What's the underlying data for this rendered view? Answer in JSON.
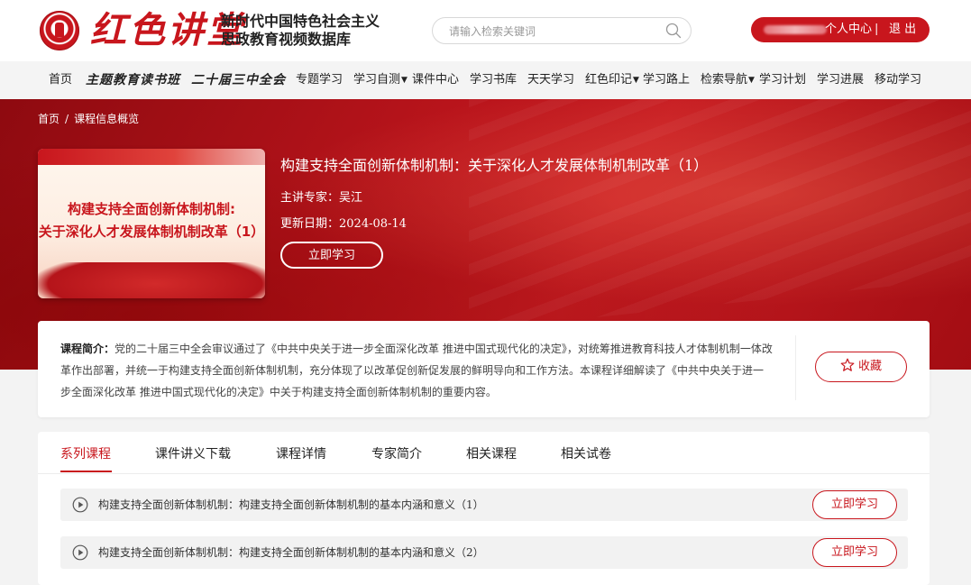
{
  "header": {
    "logo_text": "红色讲堂",
    "subtitle_line1": "新时代中国特色社会主义",
    "subtitle_line2": "思政教育视频数据库",
    "search_placeholder": "请输入检索关键词",
    "personal_center": "个人中心",
    "separator": "|",
    "logout": "退 出"
  },
  "nav": {
    "items": [
      {
        "label": "首页"
      },
      {
        "label": "主题教育读书班"
      },
      {
        "label": "二十届三中全会"
      },
      {
        "label": "专题学习"
      },
      {
        "label": "学习自测",
        "caret": "▼"
      },
      {
        "label": "课件中心"
      },
      {
        "label": "学习书库"
      },
      {
        "label": "天天学习"
      },
      {
        "label": "红色印记",
        "caret": "▼"
      },
      {
        "label": "学习路上"
      },
      {
        "label": "检索导航",
        "caret": "▼"
      },
      {
        "label": "学习计划"
      },
      {
        "label": "学习进展"
      },
      {
        "label": "移动学习"
      }
    ]
  },
  "breadcrumb": {
    "home": "首页",
    "sep": "/",
    "current": "课程信息概览"
  },
  "course": {
    "cover_line1": "构建支持全面创新体制机制:",
    "cover_line2": "关于深化人才发展体制机制改革（1）",
    "title": "构建支持全面创新体制机制：关于深化人才发展体制机制改革（1）",
    "expert": "主讲专家：吴江",
    "date": "更新日期：2024-08-14",
    "study_button": "立即学习"
  },
  "intro": {
    "label": "课程简介：",
    "text": "党的二十届三中全会审议通过了《中共中央关于进一步全面深化改革 推进中国式现代化的决定》，对统筹推进教育科技人才体制机制一体改革作出部署，并统一于构建支持全面创新体制机制，充分体现了以改革促创新促发展的鲜明导向和工作方法。本课程详细解读了《中共中央关于进一步全面深化改革 推进中国式现代化的决定》中关于构建支持全面创新体制机制的重要内容。",
    "favorite_button": "收藏"
  },
  "tabs": [
    {
      "label": "系列课程"
    },
    {
      "label": "课件讲义下载"
    },
    {
      "label": "课程详情"
    },
    {
      "label": "专家简介"
    },
    {
      "label": "相关课程"
    },
    {
      "label": "相关试卷"
    }
  ],
  "lessons": [
    {
      "title": "构建支持全面创新体制机制：构建支持全面创新体制机制的基本内涵和意义（1）",
      "button": "立即学习"
    },
    {
      "title": "构建支持全面创新体制机制：构建支持全面创新体制机制的基本内涵和意义（2）",
      "button": "立即学习"
    }
  ],
  "colors": {
    "brand_red": "#c8161d",
    "nav_bg": "#f4f4f4",
    "page_bg": "#f3f3f3"
  }
}
